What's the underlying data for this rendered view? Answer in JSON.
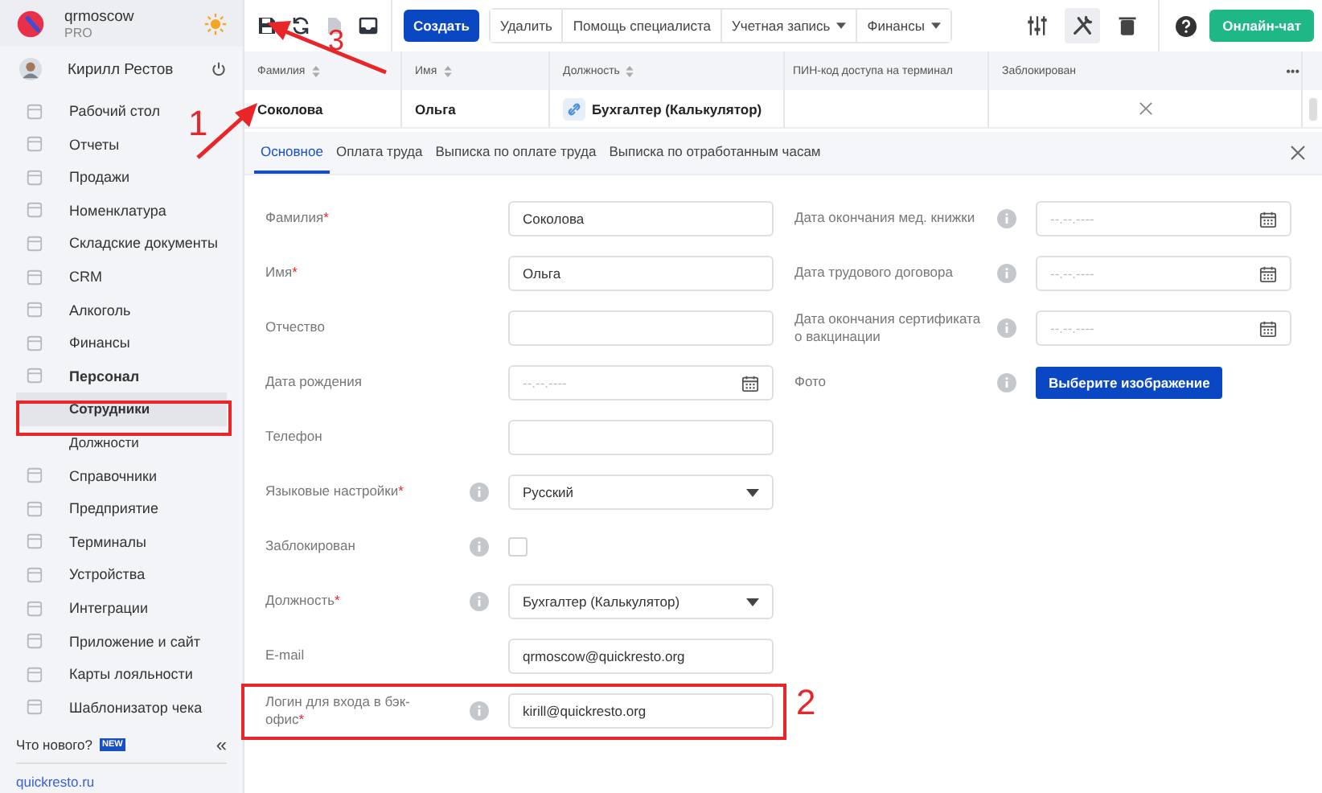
{
  "sidebar": {
    "company": {
      "name": "qrmoscow",
      "plan": "PRO"
    },
    "user": {
      "name": "Кирилл Рестов"
    },
    "items": [
      {
        "label": "Рабочий стол",
        "expanded": false,
        "selected": false
      },
      {
        "label": "Отчеты",
        "expanded": false,
        "selected": false
      },
      {
        "label": "Продажи",
        "expanded": false,
        "selected": false
      },
      {
        "label": "Номенклатура",
        "expanded": false,
        "selected": false
      },
      {
        "label": "Складские документы",
        "expanded": false,
        "selected": false
      },
      {
        "label": "CRM",
        "expanded": false,
        "selected": false
      },
      {
        "label": "Алкоголь",
        "expanded": false,
        "selected": false
      },
      {
        "label": "Финансы",
        "expanded": false,
        "selected": false
      },
      {
        "label": "Персонал",
        "expanded": true,
        "selected": false,
        "children": [
          {
            "label": "Сотрудники",
            "selected": true
          },
          {
            "label": "Должности",
            "selected": false
          }
        ]
      },
      {
        "label": "Справочники",
        "expanded": false,
        "selected": false
      },
      {
        "label": "Предприятие",
        "expanded": false,
        "selected": false
      },
      {
        "label": "Терминалы",
        "expanded": false,
        "selected": false
      },
      {
        "label": "Устройства",
        "expanded": false,
        "selected": false
      },
      {
        "label": "Интеграции",
        "expanded": false,
        "selected": false
      },
      {
        "label": "Приложение и сайт",
        "expanded": false,
        "selected": false
      },
      {
        "label": "Карты лояльности",
        "expanded": false,
        "selected": false
      },
      {
        "label": "Шаблонизатор чека",
        "expanded": false,
        "selected": false
      }
    ],
    "whats_new": {
      "label": "Что нового?",
      "badge": "NEW"
    },
    "collapse": "«",
    "link": "quickresto.ru"
  },
  "toolbar": {
    "icons": [
      {
        "kind": "save",
        "disabled": false
      },
      {
        "kind": "refresh",
        "disabled": false
      },
      {
        "kind": "copy",
        "disabled": true
      },
      {
        "kind": "inbox",
        "disabled": false
      }
    ],
    "create": "Создать",
    "buttons": [
      {
        "label": "Удалить",
        "kind": "button"
      },
      {
        "label": "Помощь специалиста",
        "kind": "button"
      },
      {
        "label": "Учетная запись",
        "kind": "dropdown"
      },
      {
        "label": "Финансы",
        "kind": "dropdown"
      }
    ],
    "right_icons": [
      {
        "kind": "sliders",
        "active": false
      },
      {
        "kind": "tools",
        "active": true
      },
      {
        "kind": "trash",
        "active": false
      }
    ],
    "chat": "Онлайн-чат"
  },
  "table": {
    "columns": [
      {
        "label": "Фамилия",
        "sortable": true
      },
      {
        "label": "Имя",
        "sortable": true
      },
      {
        "label": "Должность",
        "sortable": true
      },
      {
        "label": "ПИН-код доступа на терминал",
        "sortable": false
      },
      {
        "label": "Заблокирован",
        "sortable": false
      }
    ],
    "more": "•••",
    "rows": [
      {
        "surname": "Соколова",
        "name": "Ольга",
        "position": "Бухгалтер (Калькулятор)",
        "blocked": false
      }
    ]
  },
  "tabs": [
    {
      "label": "Основное",
      "selected": true
    },
    {
      "label": "Оплата труда",
      "selected": false
    },
    {
      "label": "Выписка по оплате труда",
      "selected": false
    },
    {
      "label": "Выписка по отработанным часам",
      "selected": false
    }
  ],
  "form": {
    "required_mark": "*",
    "left": [
      {
        "label": "Фамилия",
        "required": true,
        "info": false,
        "kind": "text",
        "value": "Соколова"
      },
      {
        "label": "Имя",
        "required": true,
        "info": false,
        "kind": "text",
        "value": "Ольга"
      },
      {
        "label": "Отчество",
        "required": false,
        "info": false,
        "kind": "text"
      },
      {
        "label": "Дата рождения",
        "required": false,
        "info": false,
        "kind": "date",
        "placeholder": "--.--.----"
      },
      {
        "label": "Телефон",
        "required": false,
        "info": false,
        "kind": "text"
      },
      {
        "label": "Языковые настройки",
        "required": true,
        "info": true,
        "kind": "select",
        "value": "Русский"
      },
      {
        "label": "Заблокирован",
        "required": false,
        "info": true,
        "kind": "checkbox",
        "checked": false
      },
      {
        "label": "Должность",
        "required": true,
        "info": true,
        "kind": "select",
        "value": "Бухгалтер (Калькулятор)"
      },
      {
        "label": "E-mail",
        "required": false,
        "info": false,
        "kind": "text",
        "value": "qrmoscow@quickresto.org"
      },
      {
        "label": "Логин для входа в бэк-офис",
        "required": true,
        "info": true,
        "kind": "text",
        "value": "kirill@quickresto.org"
      }
    ],
    "right": [
      {
        "label": "Дата окончания мед. книжки",
        "required": false,
        "info": true,
        "kind": "date",
        "placeholder": "--.--.----"
      },
      {
        "label": "Дата трудового договора",
        "required": false,
        "info": true,
        "kind": "date",
        "placeholder": "--.--.----"
      },
      {
        "label": "Дата окончания сертификата о вакцинации",
        "required": false,
        "info": true,
        "kind": "date",
        "placeholder": "--.--.----"
      },
      {
        "label": "Фото",
        "required": false,
        "info": true,
        "kind": "button",
        "value": "Выберите изображение"
      }
    ]
  },
  "annotations": [
    {
      "number": "1"
    },
    {
      "number": "2"
    },
    {
      "number": "3"
    }
  ]
}
